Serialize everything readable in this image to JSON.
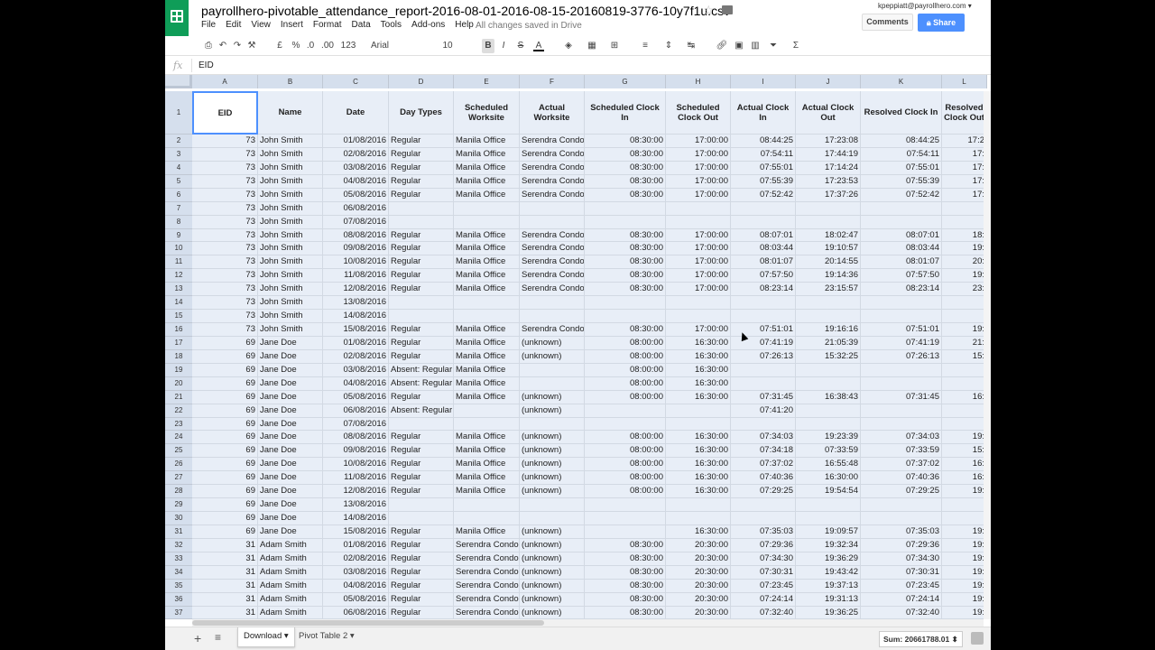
{
  "app": {
    "file_title": "payrollhero-pivotable_attendance_report-2016-08-01-2016-08-15-20160819-3776-10y7f1u.csv",
    "account": "kpeppiatt@payrollhero.com",
    "saved_status": "All changes saved in Drive",
    "comments_label": "Comments",
    "share_label": "Share",
    "menu": [
      "File",
      "Edit",
      "View",
      "Insert",
      "Format",
      "Data",
      "Tools",
      "Add-ons",
      "Help"
    ]
  },
  "toolbar": {
    "currency": "£",
    "percent": "%",
    "decimal_decrease": ".0",
    "decimal_increase": ".00",
    "more_formats": "123",
    "font": "Arial",
    "font_size": "10",
    "bold": "B",
    "italic": "I",
    "strike": "S",
    "text_color": "A",
    "sigma": "Σ"
  },
  "formula_bar": {
    "fx": "fx",
    "value": "EID"
  },
  "grid": {
    "columns": [
      "A",
      "B",
      "C",
      "D",
      "E",
      "F",
      "G",
      "H",
      "I",
      "J",
      "K",
      "L"
    ],
    "headers": [
      "EID",
      "Name",
      "Date",
      "Day Types",
      "Scheduled Worksite",
      "Actual Worksite",
      "Scheduled Clock In",
      "Scheduled Clock Out",
      "Actual Clock In",
      "Actual Clock Out",
      "Resolved Clock In",
      "Resolved Clock Out"
    ],
    "rows": [
      [
        "73",
        "John Smith",
        "01/08/2016",
        "Regular",
        "Manila Office",
        "Serendra Condo",
        "08:30:00",
        "17:00:00",
        "08:44:25",
        "17:23:08",
        "08:44:25",
        "17:2"
      ],
      [
        "73",
        "John Smith",
        "02/08/2016",
        "Regular",
        "Manila Office",
        "Serendra Condo",
        "08:30:00",
        "17:00:00",
        "07:54:11",
        "17:44:19",
        "07:54:11",
        "17:"
      ],
      [
        "73",
        "John Smith",
        "03/08/2016",
        "Regular",
        "Manila Office",
        "Serendra Condo",
        "08:30:00",
        "17:00:00",
        "07:55:01",
        "17:14:24",
        "07:55:01",
        "17:"
      ],
      [
        "73",
        "John Smith",
        "04/08/2016",
        "Regular",
        "Manila Office",
        "Serendra Condo",
        "08:30:00",
        "17:00:00",
        "07:55:39",
        "17:23:53",
        "07:55:39",
        "17:"
      ],
      [
        "73",
        "John Smith",
        "05/08/2016",
        "Regular",
        "Manila Office",
        "Serendra Condo",
        "08:30:00",
        "17:00:00",
        "07:52:42",
        "17:37:26",
        "07:52:42",
        "17:"
      ],
      [
        "73",
        "John Smith",
        "06/08/2016",
        "",
        "",
        "",
        "",
        "",
        "",
        "",
        "",
        ""
      ],
      [
        "73",
        "John Smith",
        "07/08/2016",
        "",
        "",
        "",
        "",
        "",
        "",
        "",
        "",
        ""
      ],
      [
        "73",
        "John Smith",
        "08/08/2016",
        "Regular",
        "Manila Office",
        "Serendra Condo",
        "08:30:00",
        "17:00:00",
        "08:07:01",
        "18:02:47",
        "08:07:01",
        "18:"
      ],
      [
        "73",
        "John Smith",
        "09/08/2016",
        "Regular",
        "Manila Office",
        "Serendra Condo",
        "08:30:00",
        "17:00:00",
        "08:03:44",
        "19:10:57",
        "08:03:44",
        "19:"
      ],
      [
        "73",
        "John Smith",
        "10/08/2016",
        "Regular",
        "Manila Office",
        "Serendra Condo",
        "08:30:00",
        "17:00:00",
        "08:01:07",
        "20:14:55",
        "08:01:07",
        "20:"
      ],
      [
        "73",
        "John Smith",
        "11/08/2016",
        "Regular",
        "Manila Office",
        "Serendra Condo",
        "08:30:00",
        "17:00:00",
        "07:57:50",
        "19:14:36",
        "07:57:50",
        "19:"
      ],
      [
        "73",
        "John Smith",
        "12/08/2016",
        "Regular",
        "Manila Office",
        "Serendra Condo",
        "08:30:00",
        "17:00:00",
        "08:23:14",
        "23:15:57",
        "08:23:14",
        "23:"
      ],
      [
        "73",
        "John Smith",
        "13/08/2016",
        "",
        "",
        "",
        "",
        "",
        "",
        "",
        "",
        ""
      ],
      [
        "73",
        "John Smith",
        "14/08/2016",
        "",
        "",
        "",
        "",
        "",
        "",
        "",
        "",
        ""
      ],
      [
        "73",
        "John Smith",
        "15/08/2016",
        "Regular",
        "Manila Office",
        "Serendra Condo",
        "08:30:00",
        "17:00:00",
        "07:51:01",
        "19:16:16",
        "07:51:01",
        "19:"
      ],
      [
        "69",
        "Jane Doe",
        "01/08/2016",
        "Regular",
        "Manila Office",
        "(unknown)",
        "08:00:00",
        "16:30:00",
        "07:41:19",
        "21:05:39",
        "07:41:19",
        "21:"
      ],
      [
        "69",
        "Jane Doe",
        "02/08/2016",
        "Regular",
        "Manila Office",
        "(unknown)",
        "08:00:00",
        "16:30:00",
        "07:26:13",
        "15:32:25",
        "07:26:13",
        "15:"
      ],
      [
        "69",
        "Jane Doe",
        "03/08/2016",
        "Absent: Regular",
        "Manila Office",
        "",
        "08:00:00",
        "16:30:00",
        "",
        "",
        "",
        ""
      ],
      [
        "69",
        "Jane Doe",
        "04/08/2016",
        "Absent: Regular",
        "Manila Office",
        "",
        "08:00:00",
        "16:30:00",
        "",
        "",
        "",
        ""
      ],
      [
        "69",
        "Jane Doe",
        "05/08/2016",
        "Regular",
        "Manila Office",
        "(unknown)",
        "08:00:00",
        "16:30:00",
        "07:31:45",
        "16:38:43",
        "07:31:45",
        "16:"
      ],
      [
        "69",
        "Jane Doe",
        "06/08/2016",
        "Absent: Regular",
        "",
        "(unknown)",
        "",
        "",
        "07:41:20",
        "",
        "",
        ""
      ],
      [
        "69",
        "Jane Doe",
        "07/08/2016",
        "",
        "",
        "",
        "",
        "",
        "",
        "",
        "",
        ""
      ],
      [
        "69",
        "Jane Doe",
        "08/08/2016",
        "Regular",
        "Manila Office",
        "(unknown)",
        "08:00:00",
        "16:30:00",
        "07:34:03",
        "19:23:39",
        "07:34:03",
        "19:"
      ],
      [
        "69",
        "Jane Doe",
        "09/08/2016",
        "Regular",
        "Manila Office",
        "(unknown)",
        "08:00:00",
        "16:30:00",
        "07:34:18",
        "07:33:59",
        "07:33:59",
        "15:"
      ],
      [
        "69",
        "Jane Doe",
        "10/08/2016",
        "Regular",
        "Manila Office",
        "(unknown)",
        "08:00:00",
        "16:30:00",
        "07:37:02",
        "16:55:48",
        "07:37:02",
        "16:"
      ],
      [
        "69",
        "Jane Doe",
        "11/08/2016",
        "Regular",
        "Manila Office",
        "(unknown)",
        "08:00:00",
        "16:30:00",
        "07:40:36",
        "16:30:00",
        "07:40:36",
        "16:"
      ],
      [
        "69",
        "Jane Doe",
        "12/08/2016",
        "Regular",
        "Manila Office",
        "(unknown)",
        "08:00:00",
        "16:30:00",
        "07:29:25",
        "19:54:54",
        "07:29:25",
        "19:"
      ],
      [
        "69",
        "Jane Doe",
        "13/08/2016",
        "",
        "",
        "",
        "",
        "",
        "",
        "",
        "",
        ""
      ],
      [
        "69",
        "Jane Doe",
        "14/08/2016",
        "",
        "",
        "",
        "",
        "",
        "",
        "",
        "",
        ""
      ],
      [
        "69",
        "Jane Doe",
        "15/08/2016",
        "Regular",
        "Manila Office",
        "(unknown)",
        "",
        "16:30:00",
        "07:35:03",
        "19:09:57",
        "07:35:03",
        "19:"
      ],
      [
        "31",
        "Adam Smith",
        "01/08/2016",
        "Regular",
        "Serendra Condo",
        "(unknown)",
        "08:30:00",
        "20:30:00",
        "07:29:36",
        "19:32:34",
        "07:29:36",
        "19:"
      ],
      [
        "31",
        "Adam Smith",
        "02/08/2016",
        "Regular",
        "Serendra Condo",
        "(unknown)",
        "08:30:00",
        "20:30:00",
        "07:34:30",
        "19:36:29",
        "07:34:30",
        "19:"
      ],
      [
        "31",
        "Adam Smith",
        "03/08/2016",
        "Regular",
        "Serendra Condo",
        "(unknown)",
        "08:30:00",
        "20:30:00",
        "07:30:31",
        "19:43:42",
        "07:30:31",
        "19:"
      ],
      [
        "31",
        "Adam Smith",
        "04/08/2016",
        "Regular",
        "Serendra Condo",
        "(unknown)",
        "08:30:00",
        "20:30:00",
        "07:23:45",
        "19:37:13",
        "07:23:45",
        "19:"
      ],
      [
        "31",
        "Adam Smith",
        "05/08/2016",
        "Regular",
        "Serendra Condo",
        "(unknown)",
        "08:30:00",
        "20:30:00",
        "07:24:14",
        "19:31:13",
        "07:24:14",
        "19:"
      ],
      [
        "31",
        "Adam Smith",
        "06/08/2016",
        "Regular",
        "Serendra Condo",
        "(unknown)",
        "08:30:00",
        "20:30:00",
        "07:32:40",
        "19:36:25",
        "07:32:40",
        "19:"
      ]
    ]
  },
  "sheet_tabs": {
    "add": "+",
    "list": "≡",
    "tabs": [
      "Download",
      "Pivot Table 2"
    ],
    "active": "Download",
    "sum": "Sum: 20661788.01"
  },
  "colors": {
    "sheets_green": "#0f9d58",
    "share_blue": "#4d90fe",
    "selection_fill": "#e8eef7",
    "header_fill": "#d5dfed"
  }
}
